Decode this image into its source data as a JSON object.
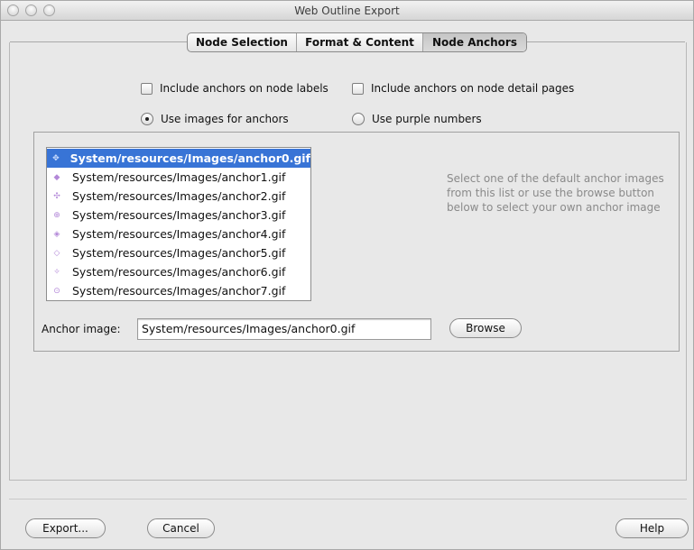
{
  "window": {
    "title": "Web Outline Export"
  },
  "tabs": [
    {
      "label": "Node Selection",
      "selected": false
    },
    {
      "label": "Format & Content",
      "selected": false
    },
    {
      "label": "Node Anchors",
      "selected": true
    }
  ],
  "options": {
    "anchors_on_labels": {
      "label": "Include anchors on node labels",
      "checked": false
    },
    "anchors_on_detail_pages": {
      "label": "Include anchors on node detail pages",
      "checked": false
    },
    "use_images": {
      "label": "Use images for anchors",
      "selected": true
    },
    "use_purple_numbers": {
      "label": "Use purple numbers",
      "selected": false
    }
  },
  "anchor_list": {
    "items": [
      {
        "label": "System/resources/Images/anchor0.gif",
        "icon": "✥",
        "selected": true
      },
      {
        "label": "System/resources/Images/anchor1.gif",
        "icon": "◆",
        "selected": false
      },
      {
        "label": "System/resources/Images/anchor2.gif",
        "icon": "✣",
        "selected": false
      },
      {
        "label": "System/resources/Images/anchor3.gif",
        "icon": "⊕",
        "selected": false
      },
      {
        "label": "System/resources/Images/anchor4.gif",
        "icon": "◈",
        "selected": false
      },
      {
        "label": "System/resources/Images/anchor5.gif",
        "icon": "◇",
        "selected": false
      },
      {
        "label": "System/resources/Images/anchor6.gif",
        "icon": "✧",
        "selected": false
      },
      {
        "label": "System/resources/Images/anchor7.gif",
        "icon": "⊙",
        "selected": false
      }
    ]
  },
  "hint_text": "Select one of the default anchor images from this list or use the browse button below to select your own anchor image",
  "anchor_image": {
    "label": "Anchor image:",
    "value": "System/resources/Images/anchor0.gif",
    "browse_label": "Browse"
  },
  "footer": {
    "export_label": "Export...",
    "cancel_label": "Cancel",
    "help_label": "Help"
  }
}
